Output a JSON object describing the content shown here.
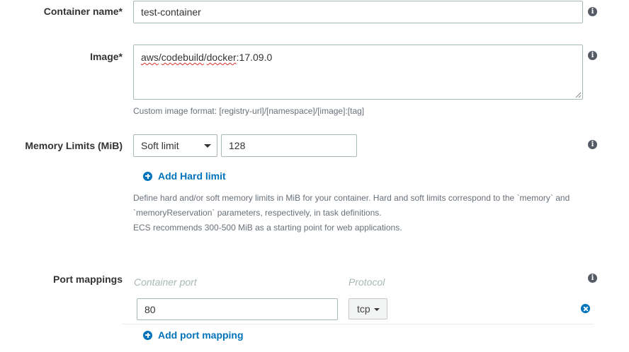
{
  "container_name": {
    "label": "Container name*",
    "value": "test-container"
  },
  "image": {
    "label": "Image*",
    "value_parts": [
      "aws",
      "/",
      "codebuild",
      "/",
      "docker",
      ":17.09.0"
    ],
    "help": "Custom image format: [registry-url]/[namespace]/[image]:[tag]"
  },
  "memory": {
    "label": "Memory Limits (MiB)",
    "limit_type": "Soft limit",
    "value": "128",
    "add_hard_limit": "Add Hard limit",
    "help_line1": "Define hard and/or soft memory limits in MiB for your container. Hard and soft limits correspond to the `memory` and",
    "help_line2": "`memoryReservation` parameters, respectively, in task definitions.",
    "help_line3": "ECS recommends 300-500 MiB as a starting point for web applications."
  },
  "ports": {
    "label": "Port mappings",
    "col_container_port": "Container port",
    "col_protocol": "Protocol",
    "rows": [
      {
        "container_port": "80",
        "protocol": "tcp"
      }
    ],
    "add_port_mapping": "Add port mapping"
  },
  "icons": {
    "info": "info-icon",
    "add": "plus-circle-icon",
    "remove": "remove-circle-icon"
  },
  "colors": {
    "link": "#0073bb",
    "info_icon": "#545b64",
    "border": "#aab7b8",
    "placeholder": "#aab7b8"
  }
}
